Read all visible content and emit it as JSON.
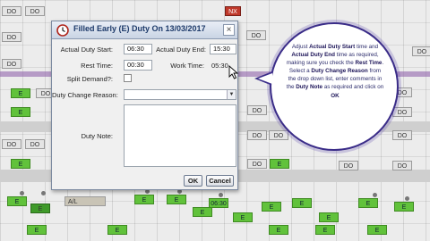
{
  "window": {
    "title": "Filled Early (E) Duty On 13/03/2017",
    "close_glyph": "×"
  },
  "form": {
    "start_label": "Actual Duty Start:",
    "start_value": "06:30",
    "end_label": "Actual Duty End:",
    "end_value": "15:30",
    "rest_label": "Rest Time:",
    "rest_value": "00:30",
    "work_label": "Work Time:",
    "work_value": "05:30",
    "split_label": "Split Demand?:",
    "split_checked": false,
    "reason_label": "Duty Change Reason:",
    "reason_value": "",
    "note_label": "Duty Note:",
    "note_value": ""
  },
  "buttons": {
    "ok": "OK",
    "cancel": "Cancel"
  },
  "callout": {
    "t1": "Adjust ",
    "b1": "Actual Duty Start",
    "t2": " time and ",
    "b2": "Actual Duty End",
    "t3": " time as required, making sure you check the ",
    "b3": "Rest Time",
    "t4": ". Select a ",
    "b4": "Duty Change Reason",
    "t5": " from the drop down list, enter comments in the ",
    "b5": "Duty Note",
    "t6": " as required and click on ",
    "b6": "OK"
  },
  "roster": {
    "cells_do": "DO",
    "cells_e": "E",
    "cells_al": "A/L",
    "cells_red": "NX",
    "cells_time": "06:30"
  },
  "colors": {
    "accent": "#3a2c88",
    "shift_green": "#61c23b",
    "purple_line": "#8a5aa8"
  },
  "icons": [
    "clock-icon",
    "close-icon",
    "dropdown-arrow-icon",
    "mouse-pointer-icon"
  ]
}
